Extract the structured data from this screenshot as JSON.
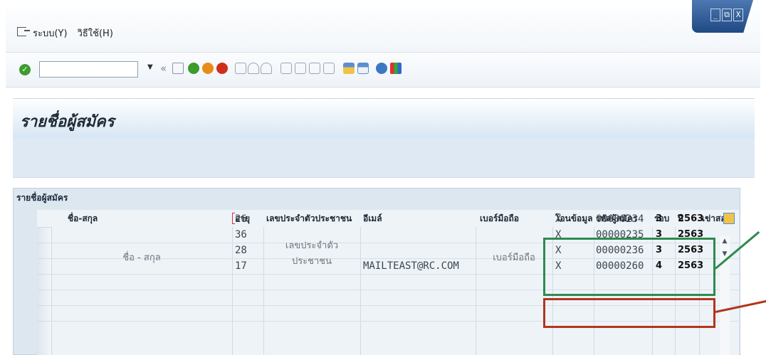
{
  "menubar": {
    "items": [
      "ระบบ(Y)",
      "วิธีใช้(H)"
    ]
  },
  "window_controls": {
    "minimize": "_",
    "restore": "⧉",
    "close": "X"
  },
  "toolbar": {
    "command_value": "",
    "collapse_glyph": "«",
    "icons": [
      "ok-icon",
      "save-icon",
      "back-icon",
      "exit-icon",
      "cancel-icon",
      "print-icon",
      "find-icon",
      "find-next-icon",
      "first-page-icon",
      "prev-page-icon",
      "next-page-icon",
      "last-page-icon",
      "new-session-icon",
      "shortcut-icon",
      "help-icon",
      "customize-layout-icon"
    ]
  },
  "page": {
    "title": "รายชื่อผู้สมัคร"
  },
  "grid": {
    "title": "รายชื่อผู้สมัคร",
    "columns": [
      "ชื่อ-สกุล",
      "อายุ",
      "เลขประจำตัวประชาชน",
      "อีเมล์",
      "เบอร์มือถือ",
      "โอนข้อมูล",
      "รหัสผู้สมัคร",
      "รอบ",
      "ปี",
      "เข่าสอ"
    ],
    "merged": {
      "name": "ชื่อ - สกุล",
      "id_card_line1": "เลขประจำตัว",
      "id_card_line2": "ประชาชน",
      "mobile": "เบอร์มือถือ"
    },
    "rows": [
      {
        "age": "26",
        "email": "",
        "transfer": "X",
        "applicant_id": "00000234",
        "round": "3",
        "year": "2563"
      },
      {
        "age": "36",
        "email": "",
        "transfer": "X",
        "applicant_id": "00000235",
        "round": "3",
        "year": "2563"
      },
      {
        "age": "28",
        "email": "",
        "transfer": "X",
        "applicant_id": "00000236",
        "round": "3",
        "year": "2563"
      },
      {
        "age": "17",
        "email": "MAILTEAST@RC.COM",
        "transfer": "X",
        "applicant_id": "00000260",
        "round": "4",
        "year": "2563"
      }
    ]
  },
  "annotations": {
    "green_color": "#2e8b4e",
    "red_color": "#b1361d"
  }
}
